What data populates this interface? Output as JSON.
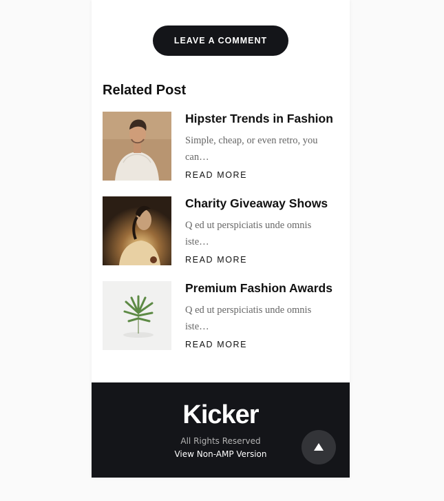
{
  "comment_button": {
    "label": "LEAVE A COMMENT"
  },
  "related": {
    "heading": "Related Post",
    "posts": [
      {
        "title": "Hipster Trends in Fashion",
        "excerpt": "Simple, cheap, or even retro, you can…",
        "read_more": "READ MORE",
        "image": "man-in-white-sweater"
      },
      {
        "title": "Charity Giveaway Shows",
        "excerpt": "Q ed ut perspiciatis unde omnis iste…",
        "read_more": "READ MORE",
        "image": "woman-in-sunlight"
      },
      {
        "title": "Premium Fashion Awards",
        "excerpt": "Q ed ut perspiciatis unde omnis iste…",
        "read_more": "READ MORE",
        "image": "green-plant-sprig"
      }
    ]
  },
  "footer": {
    "logo": "Kicker",
    "rights": "All Rights Reserved",
    "non_amp_link": "View Non-AMP Version",
    "to_top_icon": "arrow-up-icon"
  },
  "colors": {
    "dark": "#141519",
    "page_background": "#fafafa",
    "card_background": "#ffffff",
    "excerpt_text": "#666666"
  }
}
